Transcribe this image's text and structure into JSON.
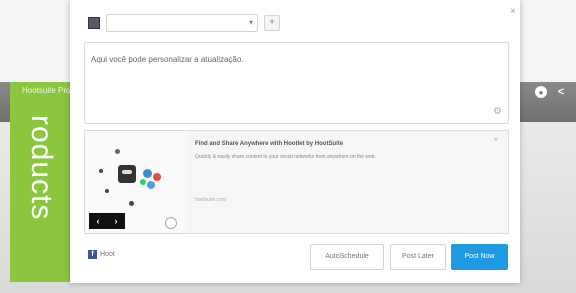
{
  "background": {
    "green_panel_label": "Hootsuite Pro",
    "vertical_text": "roducts"
  },
  "composer": {
    "profile_selected": "",
    "text": "Aqui você pode personalizar a atualização."
  },
  "preview": {
    "title": "Find and Share Anywhere with Hootlet by HootSuite",
    "description": "Quickly & easily share content to your social networks from anywhere on the web.",
    "url": "hootsuite.com",
    "nav_prev": "‹",
    "nav_next": "›"
  },
  "share": {
    "facebook_label": "Hoot"
  },
  "actions": {
    "autoschedule": "AutoSchedule",
    "post_later": "Post Later",
    "post_now": "Post Now"
  },
  "colors": {
    "accent": "#1e9ae2",
    "green": "#8cc63f",
    "facebook": "#3b5998"
  }
}
